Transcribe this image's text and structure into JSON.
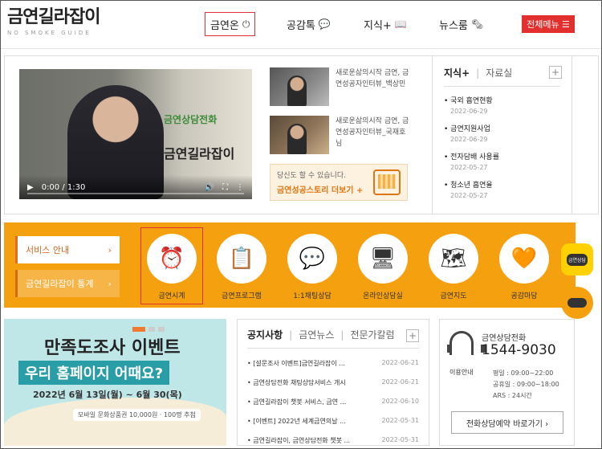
{
  "header": {
    "logo_main": "금연길라잡이",
    "logo_sub": "NO SMOKE GUIDE",
    "nav": [
      {
        "label": "금연온",
        "icon": "power-icon",
        "symbol": "⏻"
      },
      {
        "label": "공감톡",
        "icon": "chat-bubble-icon",
        "symbol": "💬"
      },
      {
        "label": "지식+",
        "icon": "book-icon",
        "symbol": "📖"
      },
      {
        "label": "뉴스룸",
        "icon": "newspaper-icon",
        "symbol": "🗞"
      }
    ],
    "menu_button": "전체메뉴 ☰"
  },
  "video": {
    "brand_line1": "금연상담전화",
    "brand_line2": "금연길라잡이",
    "time": "0:00 / 1:30",
    "play_symbol": "▶",
    "volume_symbol": "🔊",
    "fullscreen_symbol": "⛶",
    "more_symbol": "⋮"
  },
  "thumbnails": [
    {
      "text": "새로운삶의시작 금연, 금연성공자인터뷰_백상민"
    },
    {
      "text": "새로운삶의시작 금연, 금연성공자인터뷰_국재호님"
    }
  ],
  "story_box": {
    "small": "당신도 할 수 있습니다.",
    "big": "금연성공스토리 더보기 +"
  },
  "knowledge": {
    "tab_active": "지식+",
    "tab_other": "자료실",
    "plus": "+",
    "items": [
      {
        "title": "국외 흡연현황",
        "date": "2022-06-29"
      },
      {
        "title": "금연지원사업",
        "date": "2022-06-29"
      },
      {
        "title": "전자담배 사용률",
        "date": "2022-05-27"
      },
      {
        "title": "청소년 흡연율",
        "date": "2022-05-27"
      }
    ]
  },
  "service": {
    "btn1": "서비스 안내",
    "btn2": "금연길라잡이 통계",
    "arrow": "›",
    "items": [
      {
        "label": "금연시계",
        "icon": "alarm-clock-icon",
        "symbol": "⏰"
      },
      {
        "label": "금연프로그램",
        "icon": "clipboard-search-icon",
        "symbol": "📋"
      },
      {
        "label": "1:1채팅상담",
        "icon": "chat-faces-icon",
        "symbol": "💬"
      },
      {
        "label": "온라인상담실",
        "icon": "monitor-icon",
        "symbol": "🖥"
      },
      {
        "label": "금연지도",
        "icon": "map-icon",
        "symbol": "🗺"
      },
      {
        "label": "공감마당",
        "icon": "heart-hand-icon",
        "symbol": "🧡"
      }
    ]
  },
  "floating": {
    "chat_label": "금연상담"
  },
  "banner": {
    "title1": "만족도조사 이벤트",
    "title2": "우리 홈페이지 어때요?",
    "dates": "2022년 6월 13일(월) ~ 6월 30(목)",
    "prize": "모바일 문화상품권 10,000원 · 100명 추첨"
  },
  "notice": {
    "tabs": [
      "공지사항",
      "금연뉴스",
      "전문가칼럼"
    ],
    "plus": "+",
    "items": [
      {
        "title": "[설문조사 이벤트]금연길라잡이 ...",
        "date": "2022-06-21"
      },
      {
        "title": "금연상담전화 채팅상담서비스 개시",
        "date": "2022-06-21"
      },
      {
        "title": "금연길라잡이 챗봇 서비스, 금연 ...",
        "date": "2022-06-10"
      },
      {
        "title": "[이벤트] 2022년 세계금연의날 ...",
        "date": "2022-05-31"
      },
      {
        "title": "금연길라잡이, 금연상담전화 챗봇 ...",
        "date": "2022-05-31"
      }
    ]
  },
  "counsel": {
    "label": "금연상담전화",
    "phone": "1544-9030",
    "hours_title": "이용안내",
    "hours": [
      "평일 : 09:00~22:00",
      "공휴일 : 09:00~18:00",
      "ARS : 24시간"
    ],
    "book": "전화상담예약 바로가기 ›"
  }
}
